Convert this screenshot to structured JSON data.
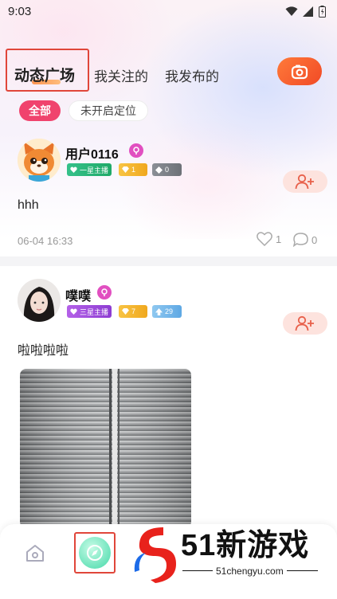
{
  "status_bar": {
    "time": "9:03"
  },
  "header": {
    "tabs": [
      {
        "label": "动态广场",
        "active": true
      },
      {
        "label": "我关注的",
        "active": false
      },
      {
        "label": "我发布的",
        "active": false
      }
    ]
  },
  "filters": {
    "all_label": "全部",
    "location_label": "未开启定位"
  },
  "posts": [
    {
      "username": "用户0116",
      "badges": [
        "一星主播",
        "1",
        "0"
      ],
      "text": "hhh",
      "timestamp": "06-04 16:33",
      "likes": "1",
      "comments": "0"
    },
    {
      "username": "噗噗",
      "badges": [
        "三星主播",
        "7",
        "29"
      ],
      "text": "啦啦啦啦"
    }
  ],
  "watermark": {
    "brand": "51新游戏",
    "url": "51chengyu.com"
  },
  "colors": {
    "accent": "#f0436d",
    "camera": "#f14a26",
    "highlight_box": "#e0463a"
  }
}
